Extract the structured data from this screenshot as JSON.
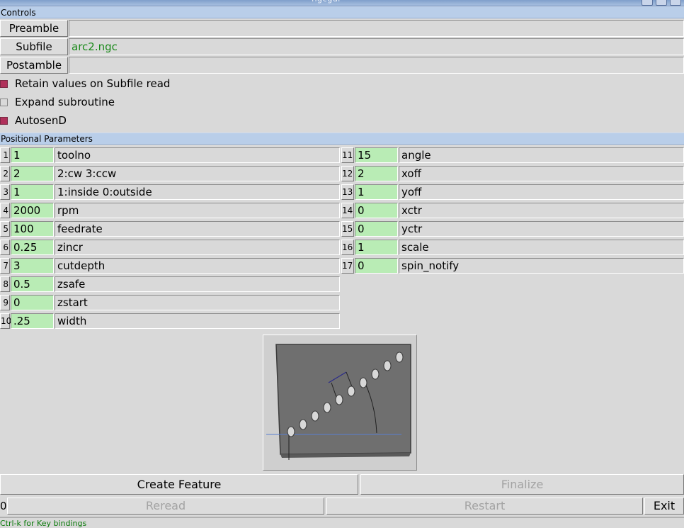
{
  "window": {
    "title": "ngcgui"
  },
  "controls_section": "Controls",
  "preamble": {
    "label": "Preamble",
    "value": ""
  },
  "subfile": {
    "label": "Subfile",
    "value": "arc2.ngc"
  },
  "postamble": {
    "label": "Postamble",
    "value": ""
  },
  "options": [
    {
      "label": "Retain values on Subfile read",
      "checked": true
    },
    {
      "label": "Expand subroutine",
      "checked": false
    },
    {
      "label": "AutosenD",
      "checked": true
    }
  ],
  "params_section": "Positional Parameters",
  "params_left": [
    {
      "num": "1",
      "value": "1",
      "desc": "toolno"
    },
    {
      "num": "2",
      "value": "2",
      "desc": "2:cw 3:ccw"
    },
    {
      "num": "3",
      "value": "1",
      "desc": "1:inside 0:outside"
    },
    {
      "num": "4",
      "value": "2000",
      "desc": "rpm"
    },
    {
      "num": "5",
      "value": "100",
      "desc": "feedrate"
    },
    {
      "num": "6",
      "value": "0.25",
      "desc": "zincr"
    },
    {
      "num": "7",
      "value": "3",
      "desc": "cutdepth"
    },
    {
      "num": "8",
      "value": "0.5",
      "desc": "zsafe"
    },
    {
      "num": "9",
      "value": "0",
      "desc": "zstart"
    },
    {
      "num": "10",
      "value": ".25",
      "desc": "width"
    }
  ],
  "params_right": [
    {
      "num": "11",
      "value": "15",
      "desc": "angle"
    },
    {
      "num": "12",
      "value": "2",
      "desc": "xoff"
    },
    {
      "num": "13",
      "value": "1",
      "desc": "yoff"
    },
    {
      "num": "14",
      "value": "0",
      "desc": "xctr"
    },
    {
      "num": "15",
      "value": "0",
      "desc": "yctr"
    },
    {
      "num": "16",
      "value": "1",
      "desc": "scale"
    },
    {
      "num": "17",
      "value": "0",
      "desc": "spin_notify"
    }
  ],
  "buttons": {
    "create_feature": "Create Feature",
    "finalize": "Finalize",
    "counter": "0",
    "reread": "Reread",
    "restart": "Restart",
    "exit": "Exit"
  },
  "status_text": "Ctrl-k for Key bindings",
  "colors": {
    "entry_green": "#b9ecb5",
    "check_on": "#b0305a",
    "section_bar": "#b9cee9"
  }
}
